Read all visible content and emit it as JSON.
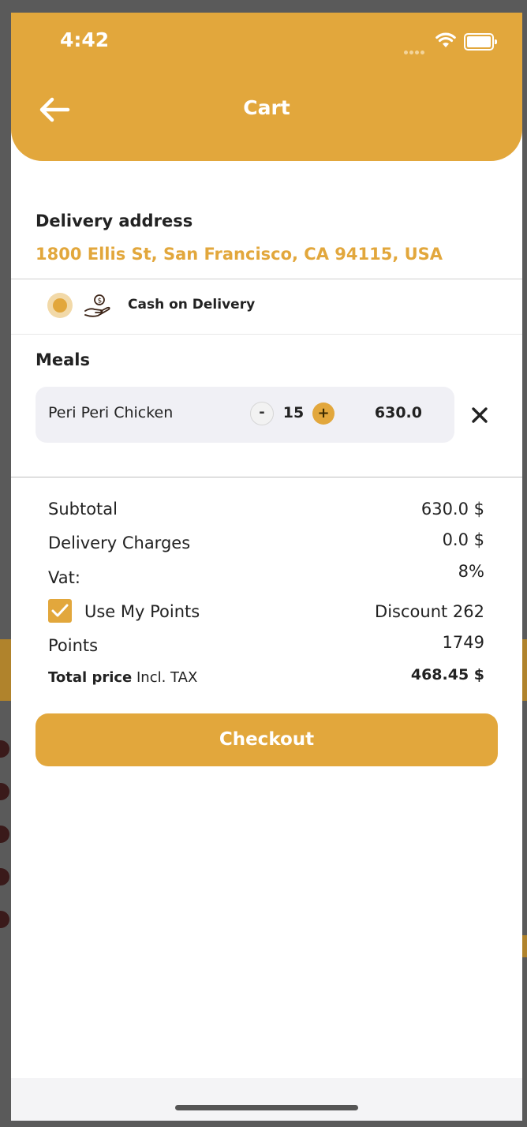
{
  "status_bar": {
    "time": "4:42"
  },
  "header": {
    "title": "Cart"
  },
  "delivery": {
    "label": "Delivery address",
    "address": "1800 Ellis St, San Francisco, CA 94115, USA"
  },
  "payment": {
    "method_label": "Cash on Delivery",
    "selected": true
  },
  "meals": {
    "title": "Meals",
    "items": [
      {
        "name": "Peri Peri Chicken",
        "quantity": "15",
        "price": "630.0",
        "minus": "-",
        "plus": "+"
      }
    ]
  },
  "summary": {
    "subtotal_label": "Subtotal",
    "subtotal_value": "630.0 $",
    "delivery_label": "Delivery Charges",
    "delivery_value": "0.0 $",
    "vat_label": "Vat:",
    "vat_value": "8%",
    "points_toggle_label": "Use My Points",
    "points_toggle_checked": true,
    "discount_value": "Discount 262",
    "points_label": "Points",
    "points_value": "1749",
    "total_label": "Total price",
    "total_suffix": "Incl. TAX",
    "total_value": "468.45 $"
  },
  "actions": {
    "checkout_label": "Checkout"
  },
  "colors": {
    "accent": "#e2a73c",
    "text": "#222222",
    "card": "#f0f0f5"
  }
}
